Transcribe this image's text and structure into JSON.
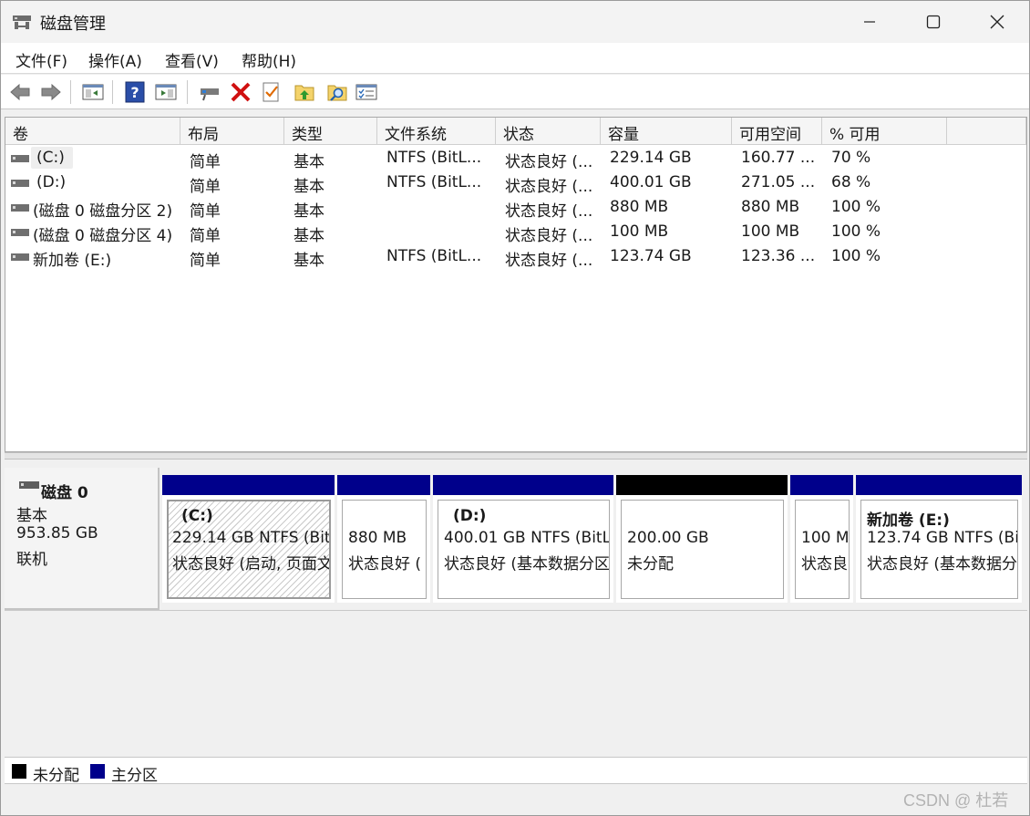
{
  "window": {
    "title": "磁盘管理"
  },
  "menu": [
    "文件(F)",
    "操作(A)",
    "查看(V)",
    "帮助(H)"
  ],
  "toolbar": {
    "icons": [
      "back-arrow-icon",
      "forward-arrow-icon",
      "show-pane-icon",
      "help-icon",
      "console-pane-icon",
      "connect-drive-icon",
      "delete-icon",
      "checklist-icon",
      "folder-up-icon",
      "folder-search-icon",
      "properties-icon"
    ]
  },
  "volume_list": {
    "columns": [
      "卷",
      "布局",
      "类型",
      "文件系统",
      "状态",
      "容量",
      "可用空间",
      "% 可用"
    ],
    "rows": [
      {
        "volume": "(C:)",
        "layout": "简单",
        "type": "基本",
        "fs": "NTFS (BitL...",
        "status": "状态良好 (...",
        "capacity": "229.14 GB",
        "free": "160.77 ...",
        "pct": "70 %"
      },
      {
        "volume": "(D:)",
        "layout": "简单",
        "type": "基本",
        "fs": "NTFS (BitL...",
        "status": "状态良好 (...",
        "capacity": "400.01 GB",
        "free": "271.05 ...",
        "pct": "68 %"
      },
      {
        "volume": "(磁盘 0 磁盘分区 2)",
        "layout": "简单",
        "type": "基本",
        "fs": "",
        "status": "状态良好 (...",
        "capacity": "880 MB",
        "free": "880 MB",
        "pct": "100 %"
      },
      {
        "volume": "(磁盘 0 磁盘分区 4)",
        "layout": "简单",
        "type": "基本",
        "fs": "",
        "status": "状态良好 (...",
        "capacity": "100 MB",
        "free": "100 MB",
        "pct": "100 %"
      },
      {
        "volume": "新加卷 (E:)",
        "layout": "简单",
        "type": "基本",
        "fs": "NTFS (BitL...",
        "status": "状态良好 (...",
        "capacity": "123.74 GB",
        "free": "123.36 ...",
        "pct": "100 %"
      }
    ]
  },
  "disk0": {
    "name": "磁盘 0",
    "kind": "基本",
    "size": "953.85 GB",
    "state": "联机",
    "partitions": [
      {
        "title": "(C:)",
        "line1": "229.14 GB NTFS (Bit",
        "line2": "状态良好 (启动, 页面文",
        "bar_color": "#00008b"
      },
      {
        "title": "",
        "line1": "880 MB",
        "line2": "状态良好 (",
        "bar_color": "#00008b"
      },
      {
        "title": "(D:)",
        "line1": "400.01 GB NTFS (BitL",
        "line2": "状态良好 (基本数据分区",
        "bar_color": "#00008b"
      },
      {
        "title": "",
        "line1": "200.00 GB",
        "line2": "未分配",
        "bar_color": "#000000"
      },
      {
        "title": "",
        "line1": "100 M",
        "line2": "状态良",
        "bar_color": "#00008b"
      },
      {
        "title": "新加卷  (E:)",
        "line1": "123.74 GB NTFS (Bi",
        "line2": "状态良好 (基本数据分",
        "bar_color": "#00008b"
      }
    ]
  },
  "legend": [
    {
      "label": "未分配",
      "color": "#000000"
    },
    {
      "label": "主分区",
      "color": "#00008b"
    }
  ],
  "watermark": "CSDN @ 杜若"
}
